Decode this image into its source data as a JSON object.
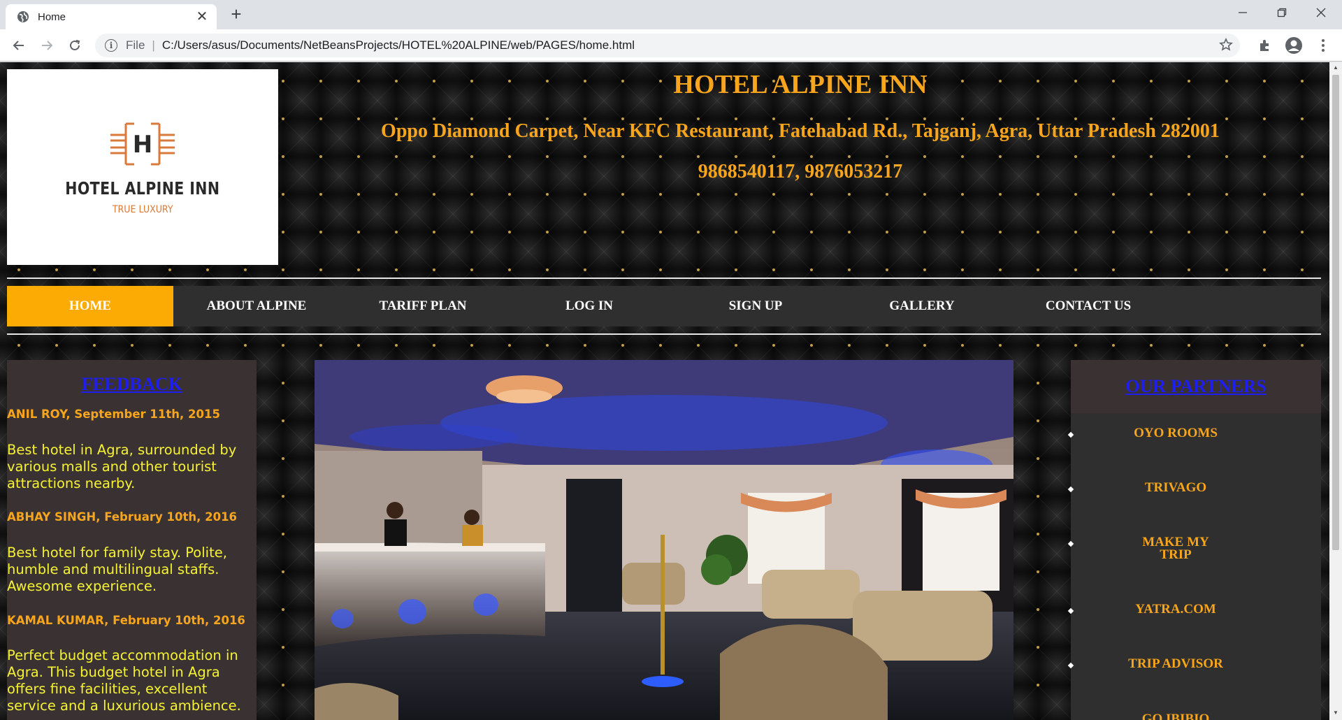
{
  "browser": {
    "tab_title": "Home",
    "address_prefix": "File",
    "address_url": "C:/Users/asus/Documents/NetBeansProjects/HOTEL%20ALPINE/web/PAGES/home.html"
  },
  "logo": {
    "letter": "H",
    "name": "HOTEL ALPINE INN",
    "tagline": "TRUE LUXURY"
  },
  "header": {
    "title": "HOTEL ALPINE INN",
    "address": "Oppo Diamond Carpet, Near KFC Restaurant, Fatehabad Rd., Tajganj, Agra, Uttar Pradesh 282001",
    "phone": "9868540117, 9876053217"
  },
  "nav": {
    "items": [
      {
        "label": "HOME"
      },
      {
        "label": "ABOUT ALPINE"
      },
      {
        "label": "TARIFF PLAN"
      },
      {
        "label": "LOG IN"
      },
      {
        "label": "SIGN UP"
      },
      {
        "label": "GALLERY"
      },
      {
        "label": "CONTACT US"
      }
    ],
    "active_index": 0
  },
  "feedback": {
    "heading": "FEEDBACK",
    "entries": [
      {
        "name": "ANIL ROY, September 11th, 2015",
        "text": "Best hotel in Agra, surrounded by various malls and other tourist attractions nearby."
      },
      {
        "name": "ABHAY SINGH, February 10th, 2016",
        "text": "Best hotel for family stay. Polite, humble and multilingual staffs. Awesome experience."
      },
      {
        "name": "KAMAL KUMAR, February 10th, 2016",
        "text": "Perfect budget accommodation in Agra. This budget hotel in Agra offers fine facilities, excellent service and a luxurious ambience."
      }
    ]
  },
  "partners": {
    "heading": "OUR PARTNERS",
    "items": [
      {
        "label": "OYO ROOMS"
      },
      {
        "label": "TRIVAGO"
      },
      {
        "label": "MAKE MY TRIP"
      },
      {
        "label": "YATRA.COM"
      },
      {
        "label": "TRIP ADVISOR"
      },
      {
        "label": "GO IBIBIO"
      }
    ]
  },
  "colors": {
    "accent_orange": "#f6a51c",
    "nav_active": "#fbab04",
    "feedback_text": "#f5f232",
    "link_blue": "#1e1ef0"
  }
}
